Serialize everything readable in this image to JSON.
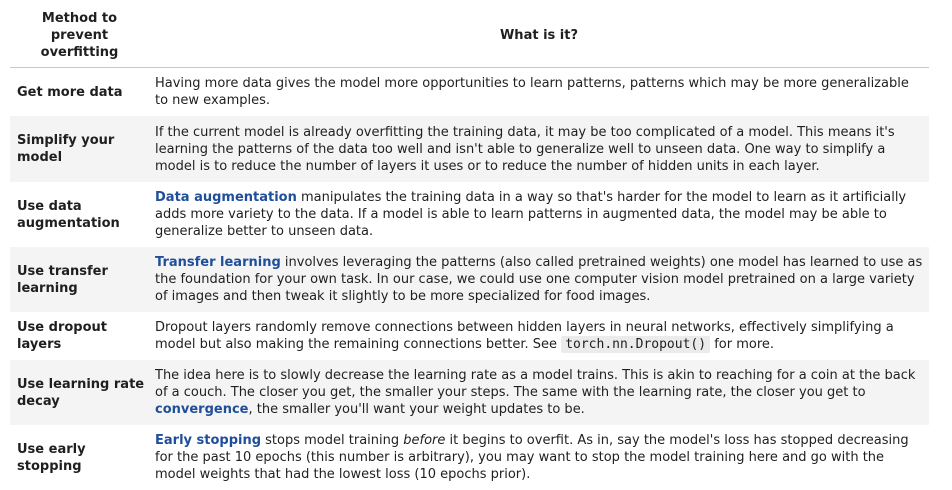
{
  "table": {
    "header": {
      "col1": "Method to prevent overfitting",
      "col2": "What is it?"
    },
    "rows": [
      {
        "method": "Get more data",
        "text": "Having more data gives the model more opportunities to learn patterns, patterns which may be more generalizable to new examples."
      },
      {
        "method": "Simplify your model",
        "text": "If the current model is already overfitting the training data, it may be too complicated of a model. This means it's learning the patterns of the data too well and isn't able to generalize well to unseen data. One way to simplify a model is to reduce the number of layers it uses or to reduce the number of hidden units in each layer."
      },
      {
        "method": "Use data augmentation",
        "link": "Data augmentation",
        "text": " manipulates the training data in a way so that's harder for the model to learn as it artificially adds more variety to the data. If a model is able to learn patterns in augmented data, the model may be able to generalize better to unseen data."
      },
      {
        "method": "Use transfer learning",
        "link": "Transfer learning",
        "text": " involves leveraging the patterns (also called pretrained weights) one model has learned to use as the foundation for your own task. In our case, we could use one computer vision model pretrained on a large variety of images and then tweak it slightly to be more specialized for food images."
      },
      {
        "method": "Use dropout layers",
        "text_before": "Dropout layers randomly remove connections between hidden layers in neural networks, effectively simplifying a model but also making the remaining connections better. See ",
        "code": "torch.nn.Dropout()",
        "text_after": " for more."
      },
      {
        "method": "Use learning rate decay",
        "text_before": "The idea here is to slowly decrease the learning rate as a model trains. This is akin to reaching for a coin at the back of a couch. The closer you get, the smaller your steps. The same with the learning rate, the closer you get to ",
        "link": "convergence",
        "text_after": ", the smaller you'll want your weight updates to be."
      },
      {
        "method": "Use early stopping",
        "link": "Early stopping",
        "text_mid1": " stops model training ",
        "emph": "before",
        "text_after": " it begins to overfit. As in, say the model's loss has stopped decreasing for the past 10 epochs (this number is arbitrary), you may want to stop the model training here and go with the model weights that had the lowest loss (10 epochs prior)."
      }
    ]
  }
}
